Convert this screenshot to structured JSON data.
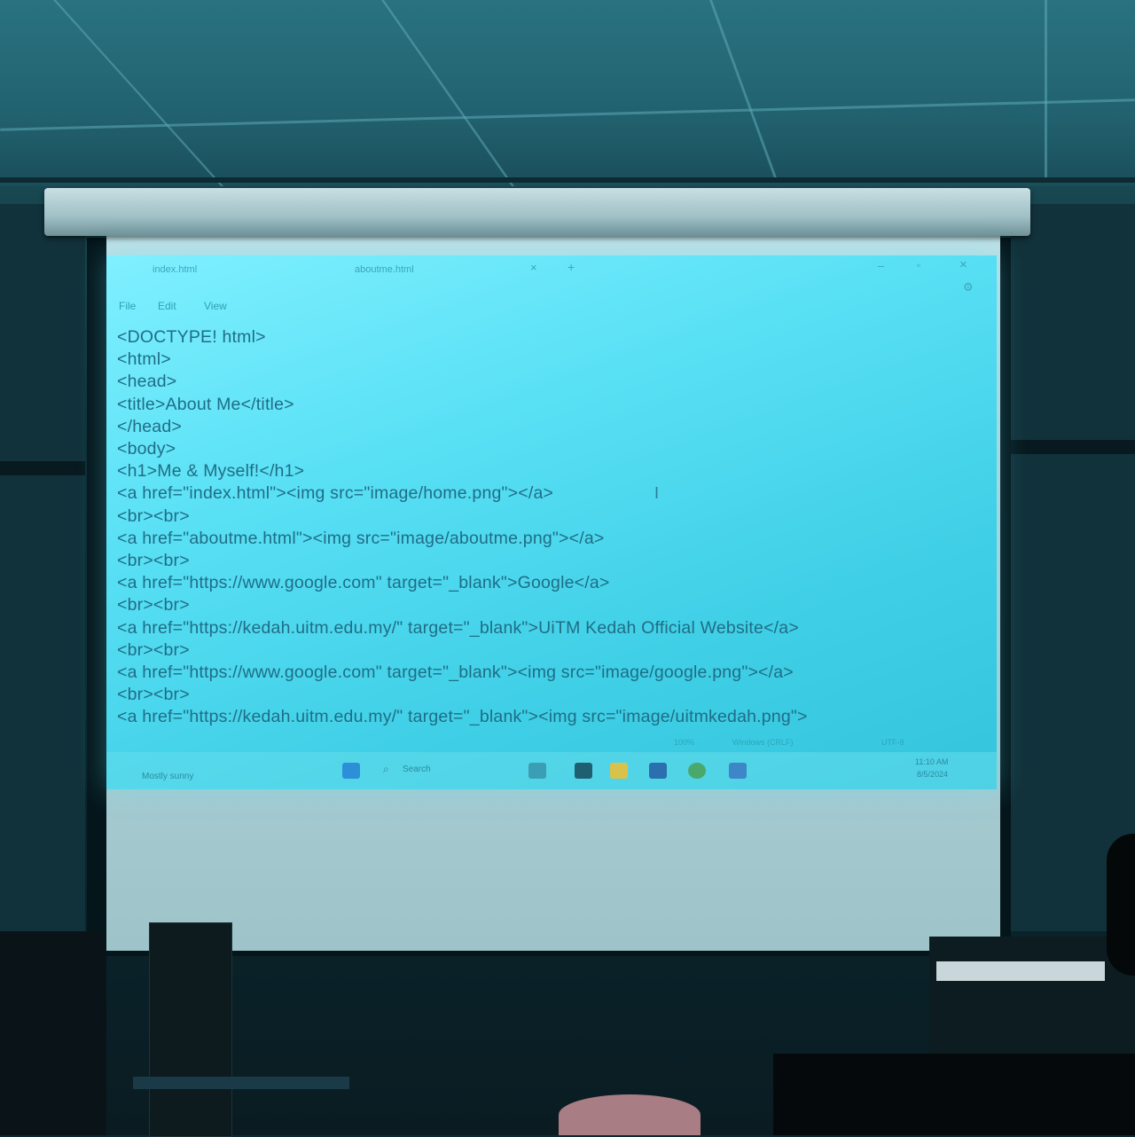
{
  "editor": {
    "tabs": [
      "index.html",
      "aboutme.html"
    ],
    "menu": [
      "File",
      "Edit",
      "View"
    ],
    "code_lines": [
      "<DOCTYPE! html>",
      "<html>",
      "<head>",
      "<title>About Me</title>",
      "</head>",
      "<body>",
      "<h1>Me & Myself!</h1>",
      "<a href=\"index.html\"><img src=\"image/home.png\"></a>",
      "<br><br>",
      "<a href=\"aboutme.html\"><img src=\"image/aboutme.png\"></a>",
      "<br><br>",
      "<a href=\"https://www.google.com\" target=\"_blank\">Google</a>",
      "<br><br>",
      "<a href=\"https://kedah.uitm.edu.my/\" target=\"_blank\">UiTM Kedah Official Website</a>",
      "<br><br>",
      "<a href=\"https://www.google.com\" target=\"_blank\"><img src=\"image/google.png\"></a>",
      "<br><br>",
      "<a href=\"https://kedah.uitm.edu.my/\" target=\"_blank\"><img src=\"image/uitmkedah.png\">"
    ],
    "status": {
      "zoom": "100%",
      "line_ending": "Windows (CRLF)",
      "encoding": "UTF-8"
    }
  },
  "taskbar": {
    "search": "Search",
    "weather": "Mostly sunny",
    "time": "11:10 AM",
    "date": "8/5/2024"
  },
  "colors": {
    "projection": "#59e0f5",
    "code_text": "#1f6d86",
    "room": "#0b262e"
  }
}
